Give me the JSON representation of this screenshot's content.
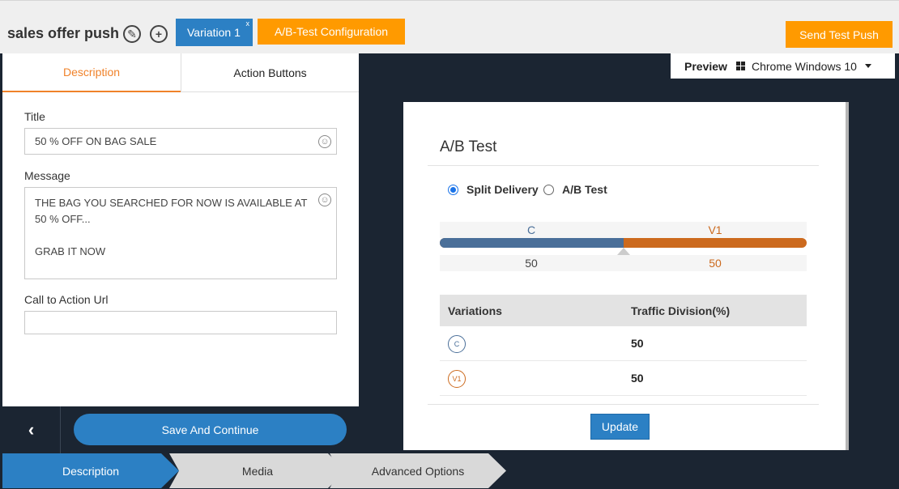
{
  "header": {
    "campaign_title": "sales offer push",
    "variation_tab": "Variation 1",
    "variation_close": "x",
    "ab_config_label": "A/B-Test Configuration",
    "send_test_label": "Send Test Push"
  },
  "left_panel": {
    "tabs": [
      "Description",
      "Action Buttons"
    ],
    "title_label": "Title",
    "title_value": "50 % OFF ON BAG SALE",
    "message_label": "Message",
    "message_line1": "THE BAG YOU SEARCHED FOR NOW IS AVAILABLE AT 50 % OFF...",
    "message_line2": "GRAB IT NOW",
    "cta_label": "Call to Action Url",
    "cta_value": "",
    "save_label": "Save And Continue"
  },
  "preview": {
    "label": "Preview",
    "device": "Chrome Windows 10"
  },
  "ab_modal": {
    "title": "A/B Test",
    "radio_options": [
      "Split Delivery",
      "A/B Test"
    ],
    "selected_option": "Split Delivery",
    "split_labels": [
      "C",
      "V1"
    ],
    "split_values": [
      "50",
      "50"
    ],
    "split_fraction_c": 0.5,
    "table_headers": [
      "Variations",
      "Traffic Division(%)"
    ],
    "rows": [
      {
        "badge": "C",
        "value": "50"
      },
      {
        "badge": "V1",
        "value": "50"
      }
    ],
    "update_label": "Update"
  },
  "stepper": [
    "Description",
    "Media",
    "Advanced Options"
  ],
  "colors": {
    "accent_blue": "#2c80c4",
    "accent_orange": "#ff9a00",
    "control_color": "#4a6f99",
    "v1_color": "#cc6a1e"
  }
}
